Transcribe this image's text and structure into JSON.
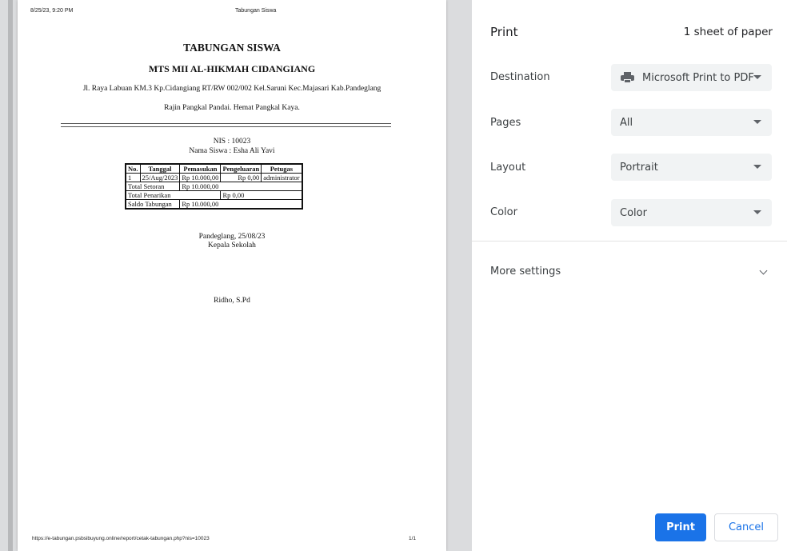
{
  "preview": {
    "header_date": "8/25/23, 9:20 PM",
    "header_title": "Tabungan Siswa",
    "footer_url": "https://e-tabungan.psbsibuyung.online/report/cetak-tabungan.php?nis=10023",
    "footer_page": "1/1",
    "document": {
      "title": "TABUNGAN SISWA",
      "school": "MTS MII AL-HIKMAH CIDANGIANG",
      "address": "Jl. Raya Labuan KM.3 Kp.Cidangiang RT/RW 002/002 Kel.Saruni Kec.Majasari Kab.Pandeglang",
      "motto": "Rajin Pangkal Pandai. Hemat Pangkal Kaya.",
      "nis": "NIS : 10023",
      "nama": "Nama Siswa : Esha Ali Yavi",
      "table": {
        "headers": [
          "No.",
          "Tanggal",
          "Pemasukan",
          "Pengeluaran",
          "Petugas"
        ],
        "row": [
          "1",
          "25/Aug/2023",
          "Rp 10.000,00",
          "Rp 0,00",
          "administrator"
        ],
        "total_setoran_label": "Total Setoran",
        "total_setoran_value": "Rp 10.000,00",
        "total_penarikan_label": "Total Penarikan",
        "total_penarikan_value": "Rp 0,00",
        "saldo_label": "Saldo Tabungan",
        "saldo_value": "Rp 10.000,00"
      },
      "place_date": "Pandeglang, 25/08/23",
      "role": "Kepala Sekolah",
      "signatory": "Ridho, S.Pd"
    }
  },
  "panel": {
    "title": "Print",
    "sheet_count": "1 sheet of paper",
    "destination_label": "Destination",
    "destination_value": "Microsoft Print to PDF",
    "destination_icon": "printer-icon",
    "pages_label": "Pages",
    "pages_value": "All",
    "layout_label": "Layout",
    "layout_value": "Portrait",
    "color_label": "Color",
    "color_value": "Color",
    "more_settings": "More settings",
    "print_button": "Print",
    "cancel_button": "Cancel",
    "accent_color": "#1a73e8"
  }
}
